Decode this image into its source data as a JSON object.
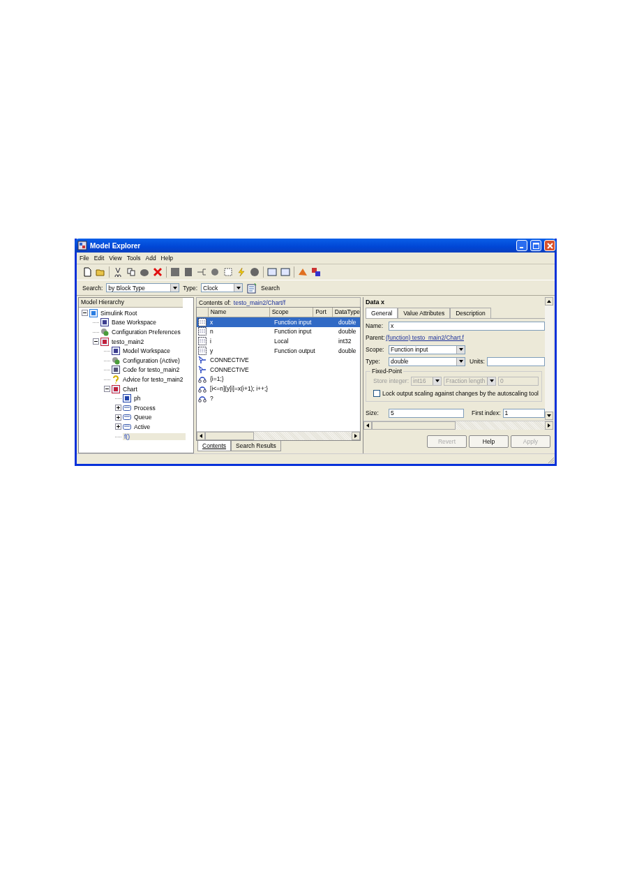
{
  "window": {
    "title": "Model Explorer"
  },
  "menu": [
    "File",
    "Edit",
    "View",
    "Tools",
    "Add",
    "Help"
  ],
  "search_bar": {
    "search_label": "Search:",
    "search_by": "by Block Type",
    "type_label": "Type:",
    "type_value": "Clock",
    "search_button": "Search"
  },
  "hierarchy": {
    "title": "Model Hierarchy",
    "items": [
      {
        "label": "Simulink Root",
        "kind": "root",
        "expanded": true,
        "selected": false,
        "children": [
          {
            "label": "Base Workspace",
            "kind": "workspace",
            "selected": false
          },
          {
            "label": "Configuration Preferences",
            "kind": "config",
            "selected": false
          },
          {
            "label": "testo_main2",
            "kind": "model",
            "expanded": true,
            "selected": false,
            "children": [
              {
                "label": "Model Workspace",
                "kind": "workspace",
                "selected": false
              },
              {
                "label": "Configuration (Active)",
                "kind": "config",
                "selected": false
              },
              {
                "label": "Code for testo_main2",
                "kind": "code",
                "selected": false
              },
              {
                "label": "Advice for testo_main2",
                "kind": "advice",
                "selected": false
              },
              {
                "label": "Chart",
                "kind": "chart",
                "expanded": true,
                "selected": false,
                "children": [
                  {
                    "label": "ph",
                    "kind": "truthtable",
                    "selected": false
                  },
                  {
                    "label": "Process",
                    "kind": "state",
                    "expanded": false,
                    "selected": false
                  },
                  {
                    "label": "Queue",
                    "kind": "state",
                    "expanded": false,
                    "selected": false
                  },
                  {
                    "label": "Active",
                    "kind": "state",
                    "expanded": false,
                    "selected": false
                  },
                  {
                    "label": "f()",
                    "kind": "function",
                    "selected": true
                  }
                ]
              }
            ]
          }
        ]
      }
    ]
  },
  "contents": {
    "title_prefix": "Contents of:",
    "path": "testo_main2/Chart/f",
    "columns": [
      "Name",
      "Scope",
      "Port",
      "DataType"
    ],
    "rows": [
      {
        "kind": "data",
        "name": "x",
        "scope": "Function input",
        "datatype": "double",
        "selected": true
      },
      {
        "kind": "data",
        "name": "n",
        "scope": "Function input",
        "datatype": "double",
        "selected": false
      },
      {
        "kind": "data",
        "name": "i",
        "scope": "Local",
        "datatype": "int32",
        "selected": false
      },
      {
        "kind": "data",
        "name": "y",
        "scope": "Function output",
        "datatype": "double",
        "selected": false
      },
      {
        "kind": "connective",
        "name": "CONNECTIVE",
        "selected": false
      },
      {
        "kind": "connective",
        "name": "CONNECTIVE",
        "selected": false
      },
      {
        "kind": "transition",
        "name": "{i=1;}",
        "selected": false
      },
      {
        "kind": "transition",
        "name": "[i<=n]{y[i]=x(i+1); i++;}",
        "selected": false
      },
      {
        "kind": "transition",
        "name": "?",
        "selected": false
      }
    ],
    "tabs": [
      {
        "label": "Contents",
        "selected": true
      },
      {
        "label": "Search Results",
        "selected": false
      }
    ]
  },
  "dialog": {
    "title": "Data x",
    "tabs": [
      {
        "label": "General",
        "selected": true
      },
      {
        "label": "Value Attributes",
        "selected": false
      },
      {
        "label": "Description",
        "selected": false
      }
    ],
    "name_label": "Name:",
    "name_value": "x",
    "parent_label": "Parent:",
    "parent_link": "(function) testo_main2/Chart.f",
    "scope_label": "Scope:",
    "scope_value": "Function input",
    "type_label": "Type:",
    "type_value": "double",
    "units_label": "Units:",
    "fixed_point": {
      "title": "Fixed-Point",
      "store_label": "Store integer:",
      "store_value": "int16",
      "fraction_value": "Fraction length",
      "fraction_number": "0",
      "disabled": true
    },
    "lock_label": "Lock output scaling against changes by the autoscaling tool",
    "lock_checked": false,
    "size_label": "Size:",
    "size_value": "5",
    "first_index_label": "First index:",
    "first_index_value": "1",
    "buttons": [
      {
        "label": "Revert",
        "disabled": true
      },
      {
        "label": "Help",
        "disabled": false
      },
      {
        "label": "Apply",
        "disabled": true
      }
    ]
  }
}
